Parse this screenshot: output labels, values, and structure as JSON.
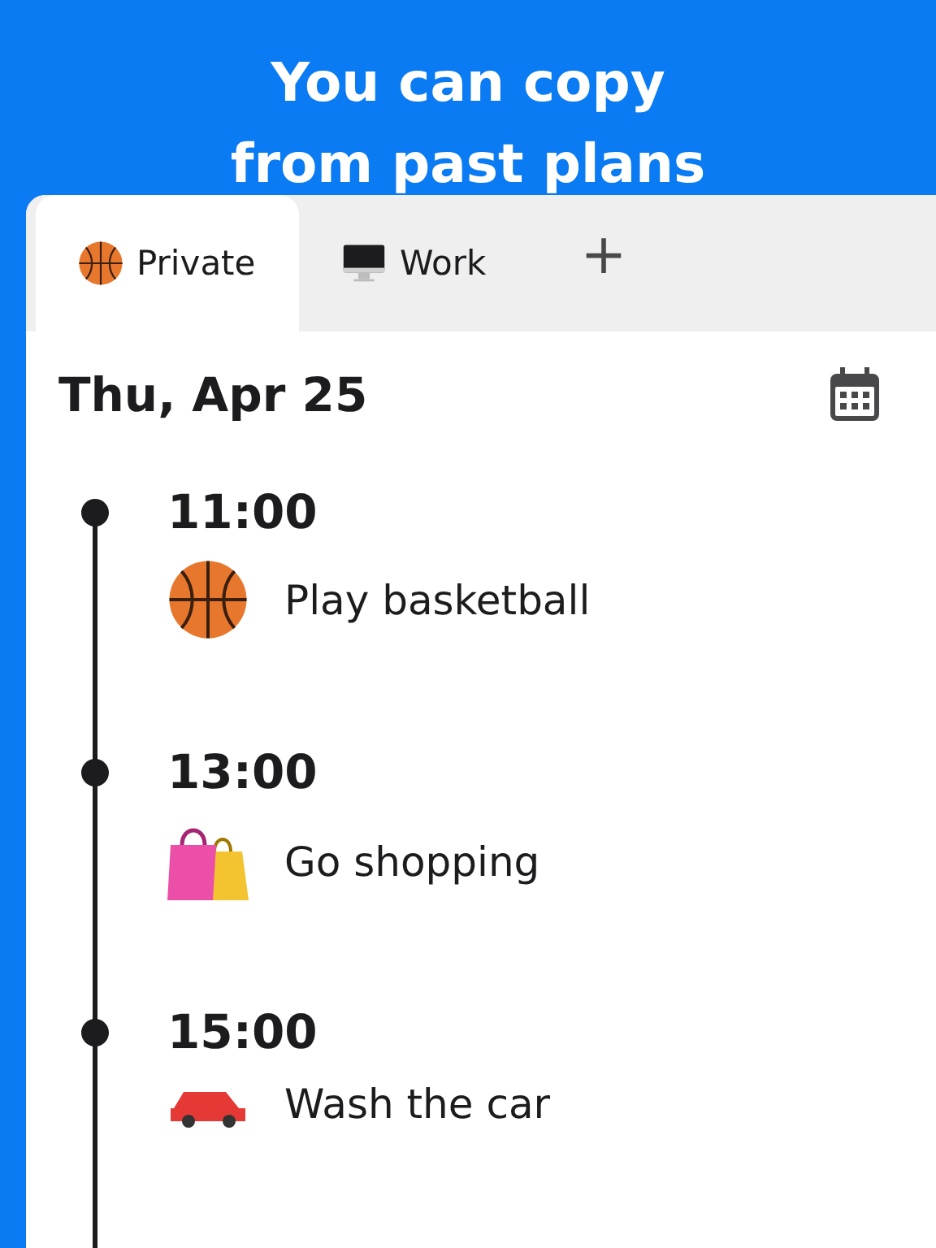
{
  "headline": [
    "You can copy",
    "from past plans"
  ],
  "tabs": [
    {
      "label": "Private",
      "selected": true,
      "kind": "basketball"
    },
    {
      "label": "Work",
      "selected": false,
      "kind": "monitor"
    }
  ],
  "add_tab": "+",
  "date": "Thu, Apr 25",
  "schedule": [
    {
      "time": "11:00",
      "title": "Play basketball",
      "kind": "basketball"
    },
    {
      "time": "13:00",
      "title": "Go shopping",
      "kind": "bags"
    },
    {
      "time": "15:00",
      "title": "Wash the car",
      "kind": "car"
    }
  ]
}
